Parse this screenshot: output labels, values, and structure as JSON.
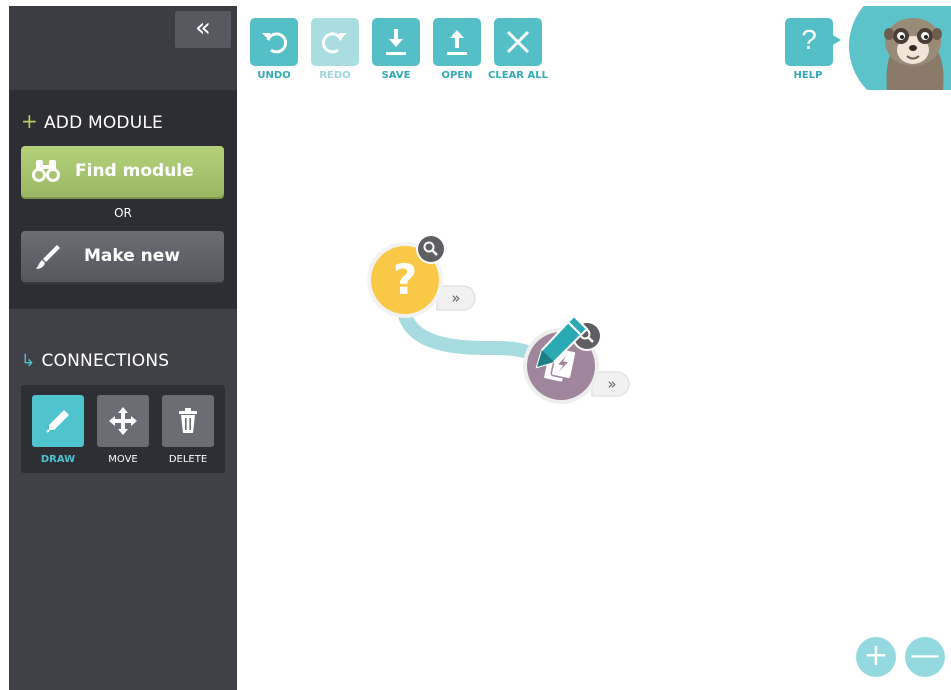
{
  "sidebar": {
    "collapse_icon": "double-chevron-left-icon",
    "collapse_label": "«",
    "add_module": {
      "glyph": "+",
      "title": "ADD MODULE",
      "find_label": "Find module",
      "or_label": "OR",
      "make_label": "Make new"
    },
    "connections": {
      "glyph": "↳",
      "title": "CONNECTIONS",
      "tools": [
        {
          "label": "DRAW",
          "icon": "pencil-icon",
          "active": true
        },
        {
          "label": "MOVE",
          "icon": "move-arrows-icon",
          "active": false
        },
        {
          "label": "DELETE",
          "icon": "trash-icon",
          "active": false
        }
      ]
    }
  },
  "toolbar": {
    "undo": "UNDO",
    "redo": "REDO",
    "save": "SAVE",
    "open": "OPEN",
    "clear_all": "CLEAR ALL",
    "help": "HELP",
    "help_glyph": "?"
  },
  "canvas": {
    "modules": [
      {
        "name": "unknown-module",
        "glyph": "?",
        "color": "#f9c846"
      },
      {
        "name": "action-card-module",
        "color": "#a0869d"
      }
    ],
    "connector_color": "#a6dbe0",
    "expand_label": "»",
    "zoom_in": "+",
    "zoom_out": "—"
  },
  "colors": {
    "accent": "#54bfc6",
    "sidebar": "#3f4147",
    "find_green": "#a7c46e"
  }
}
